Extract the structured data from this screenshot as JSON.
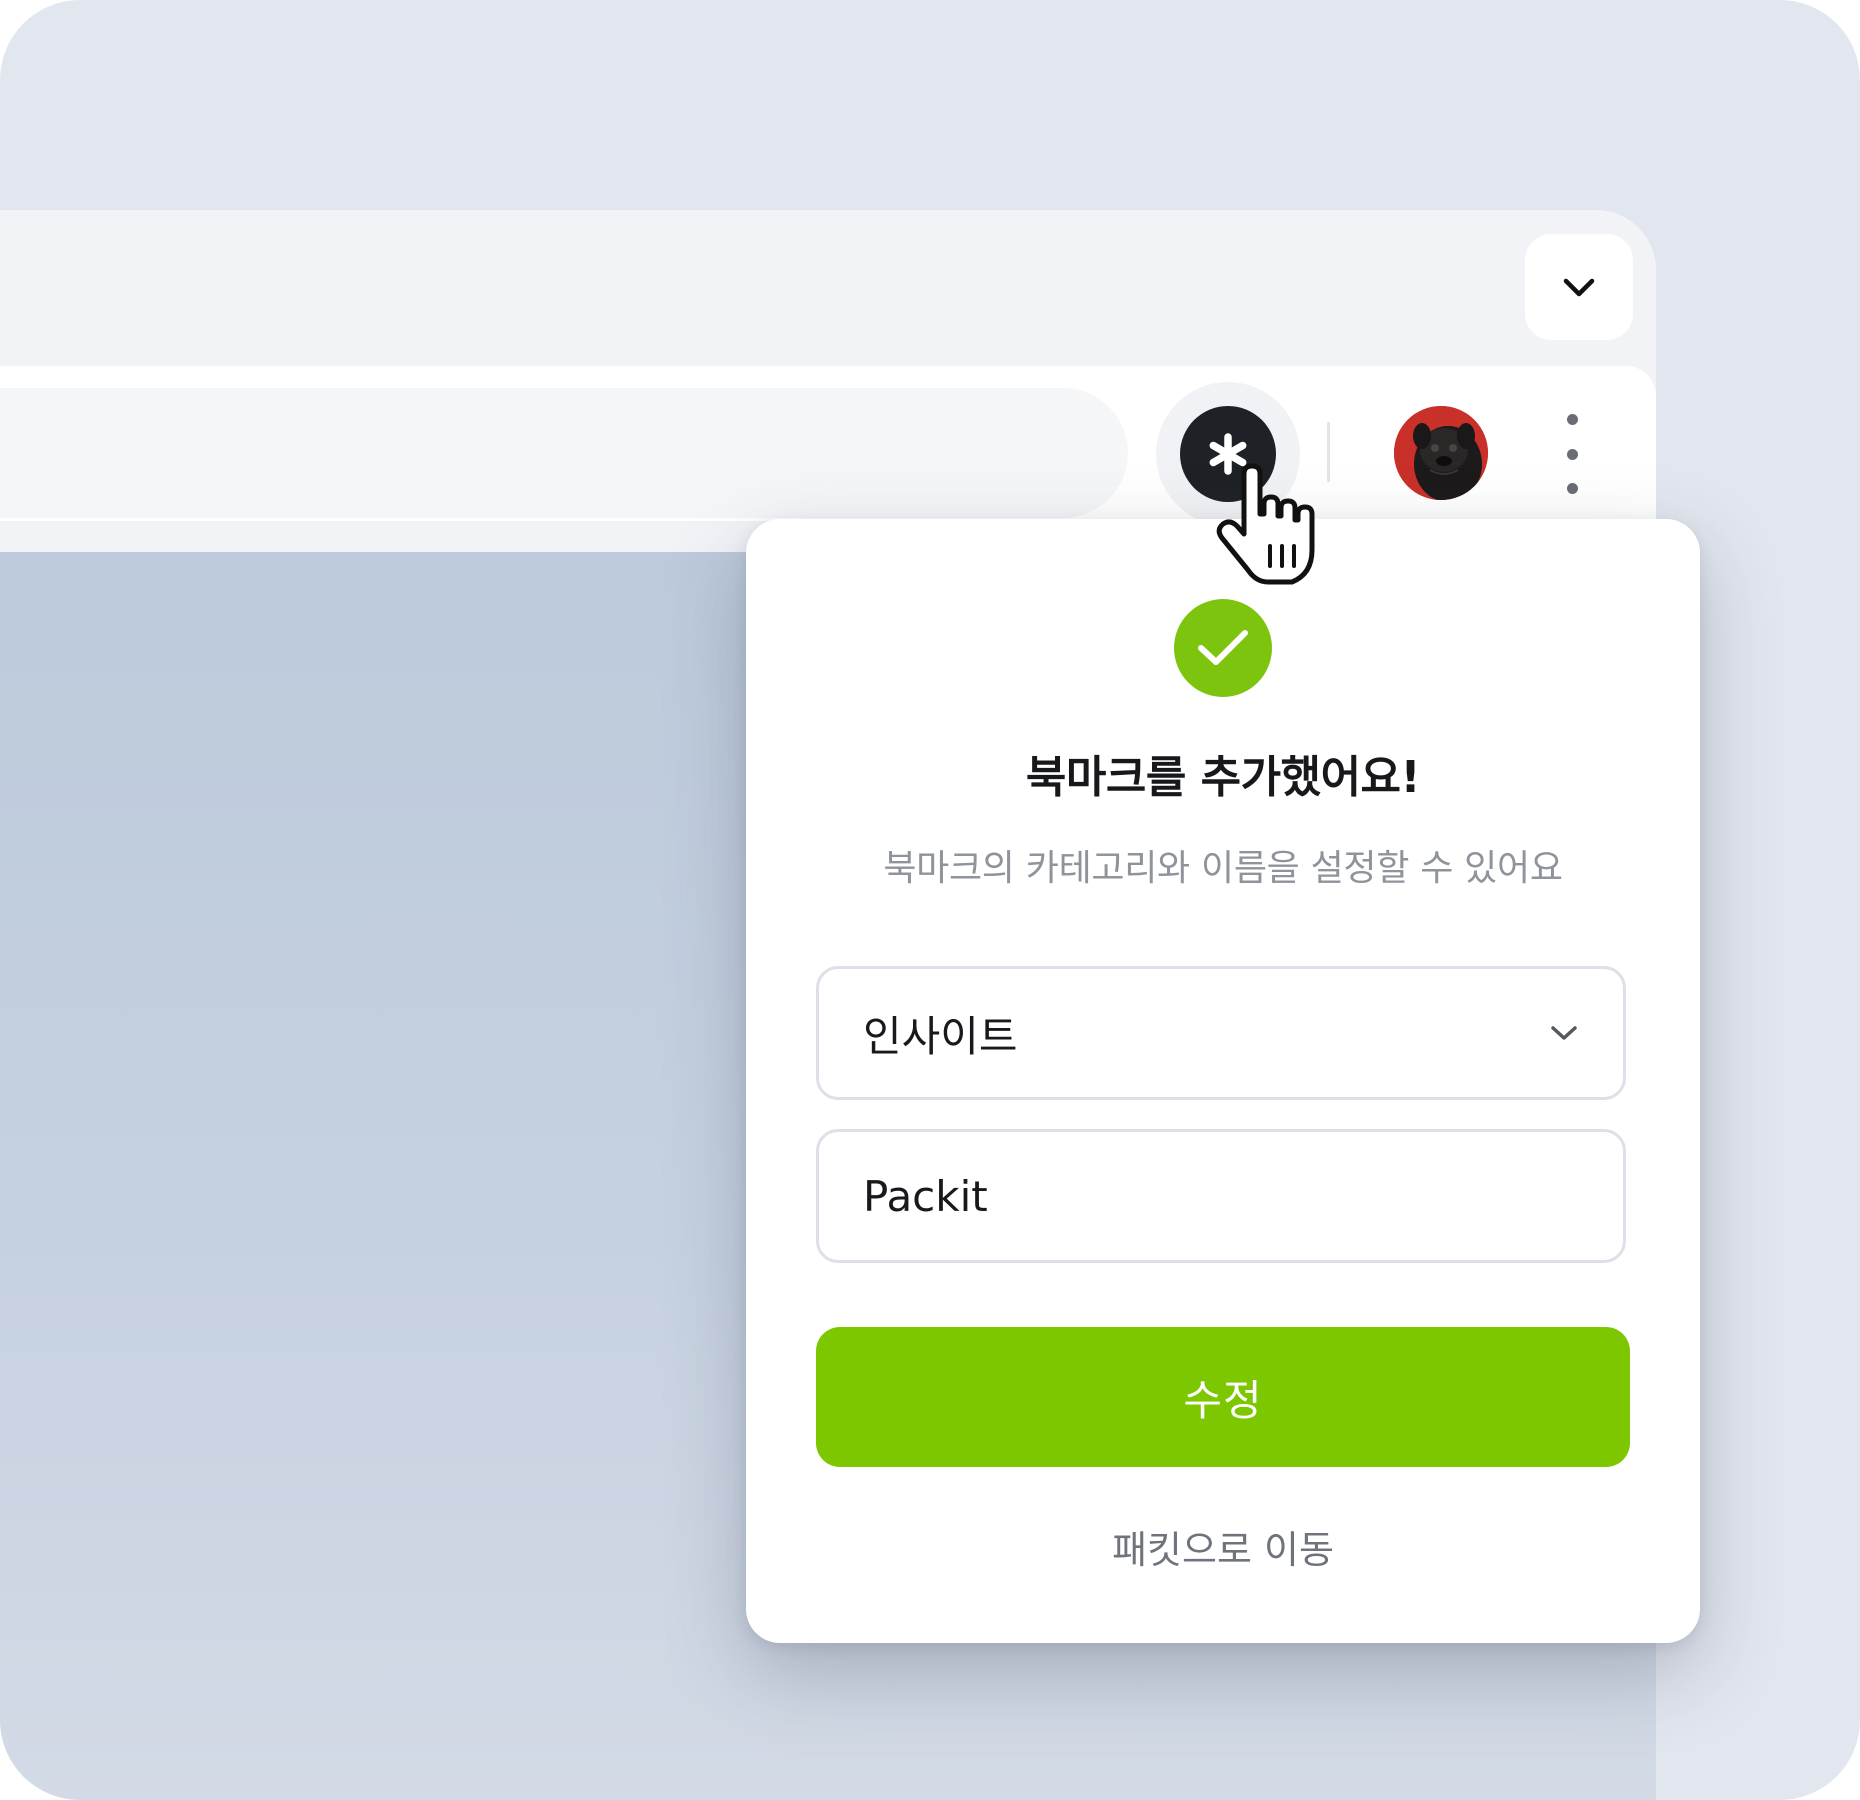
{
  "browser": {
    "tab_menu_icon": "chevron-down-icon",
    "extension_icon": "asterisk-icon",
    "avatar_icon": "pug-avatar",
    "more_menu_icon": "vertical-dots-icon"
  },
  "popup": {
    "status_icon": "check-circle-icon",
    "title": "북마크를 추가했어요!",
    "subtitle": "북마크의 카테고리와 이름을 설정할 수 있어요",
    "category": {
      "selected": "인사이트",
      "icon": "chevron-down-icon"
    },
    "name": {
      "value": "Packit"
    },
    "submit_label": "수정",
    "link_label": "패킷으로 이동"
  },
  "colors": {
    "accent": "#7dc700",
    "success": "#7dc40f",
    "extension_button": "#1e2125",
    "background": "#e2e6ee"
  }
}
